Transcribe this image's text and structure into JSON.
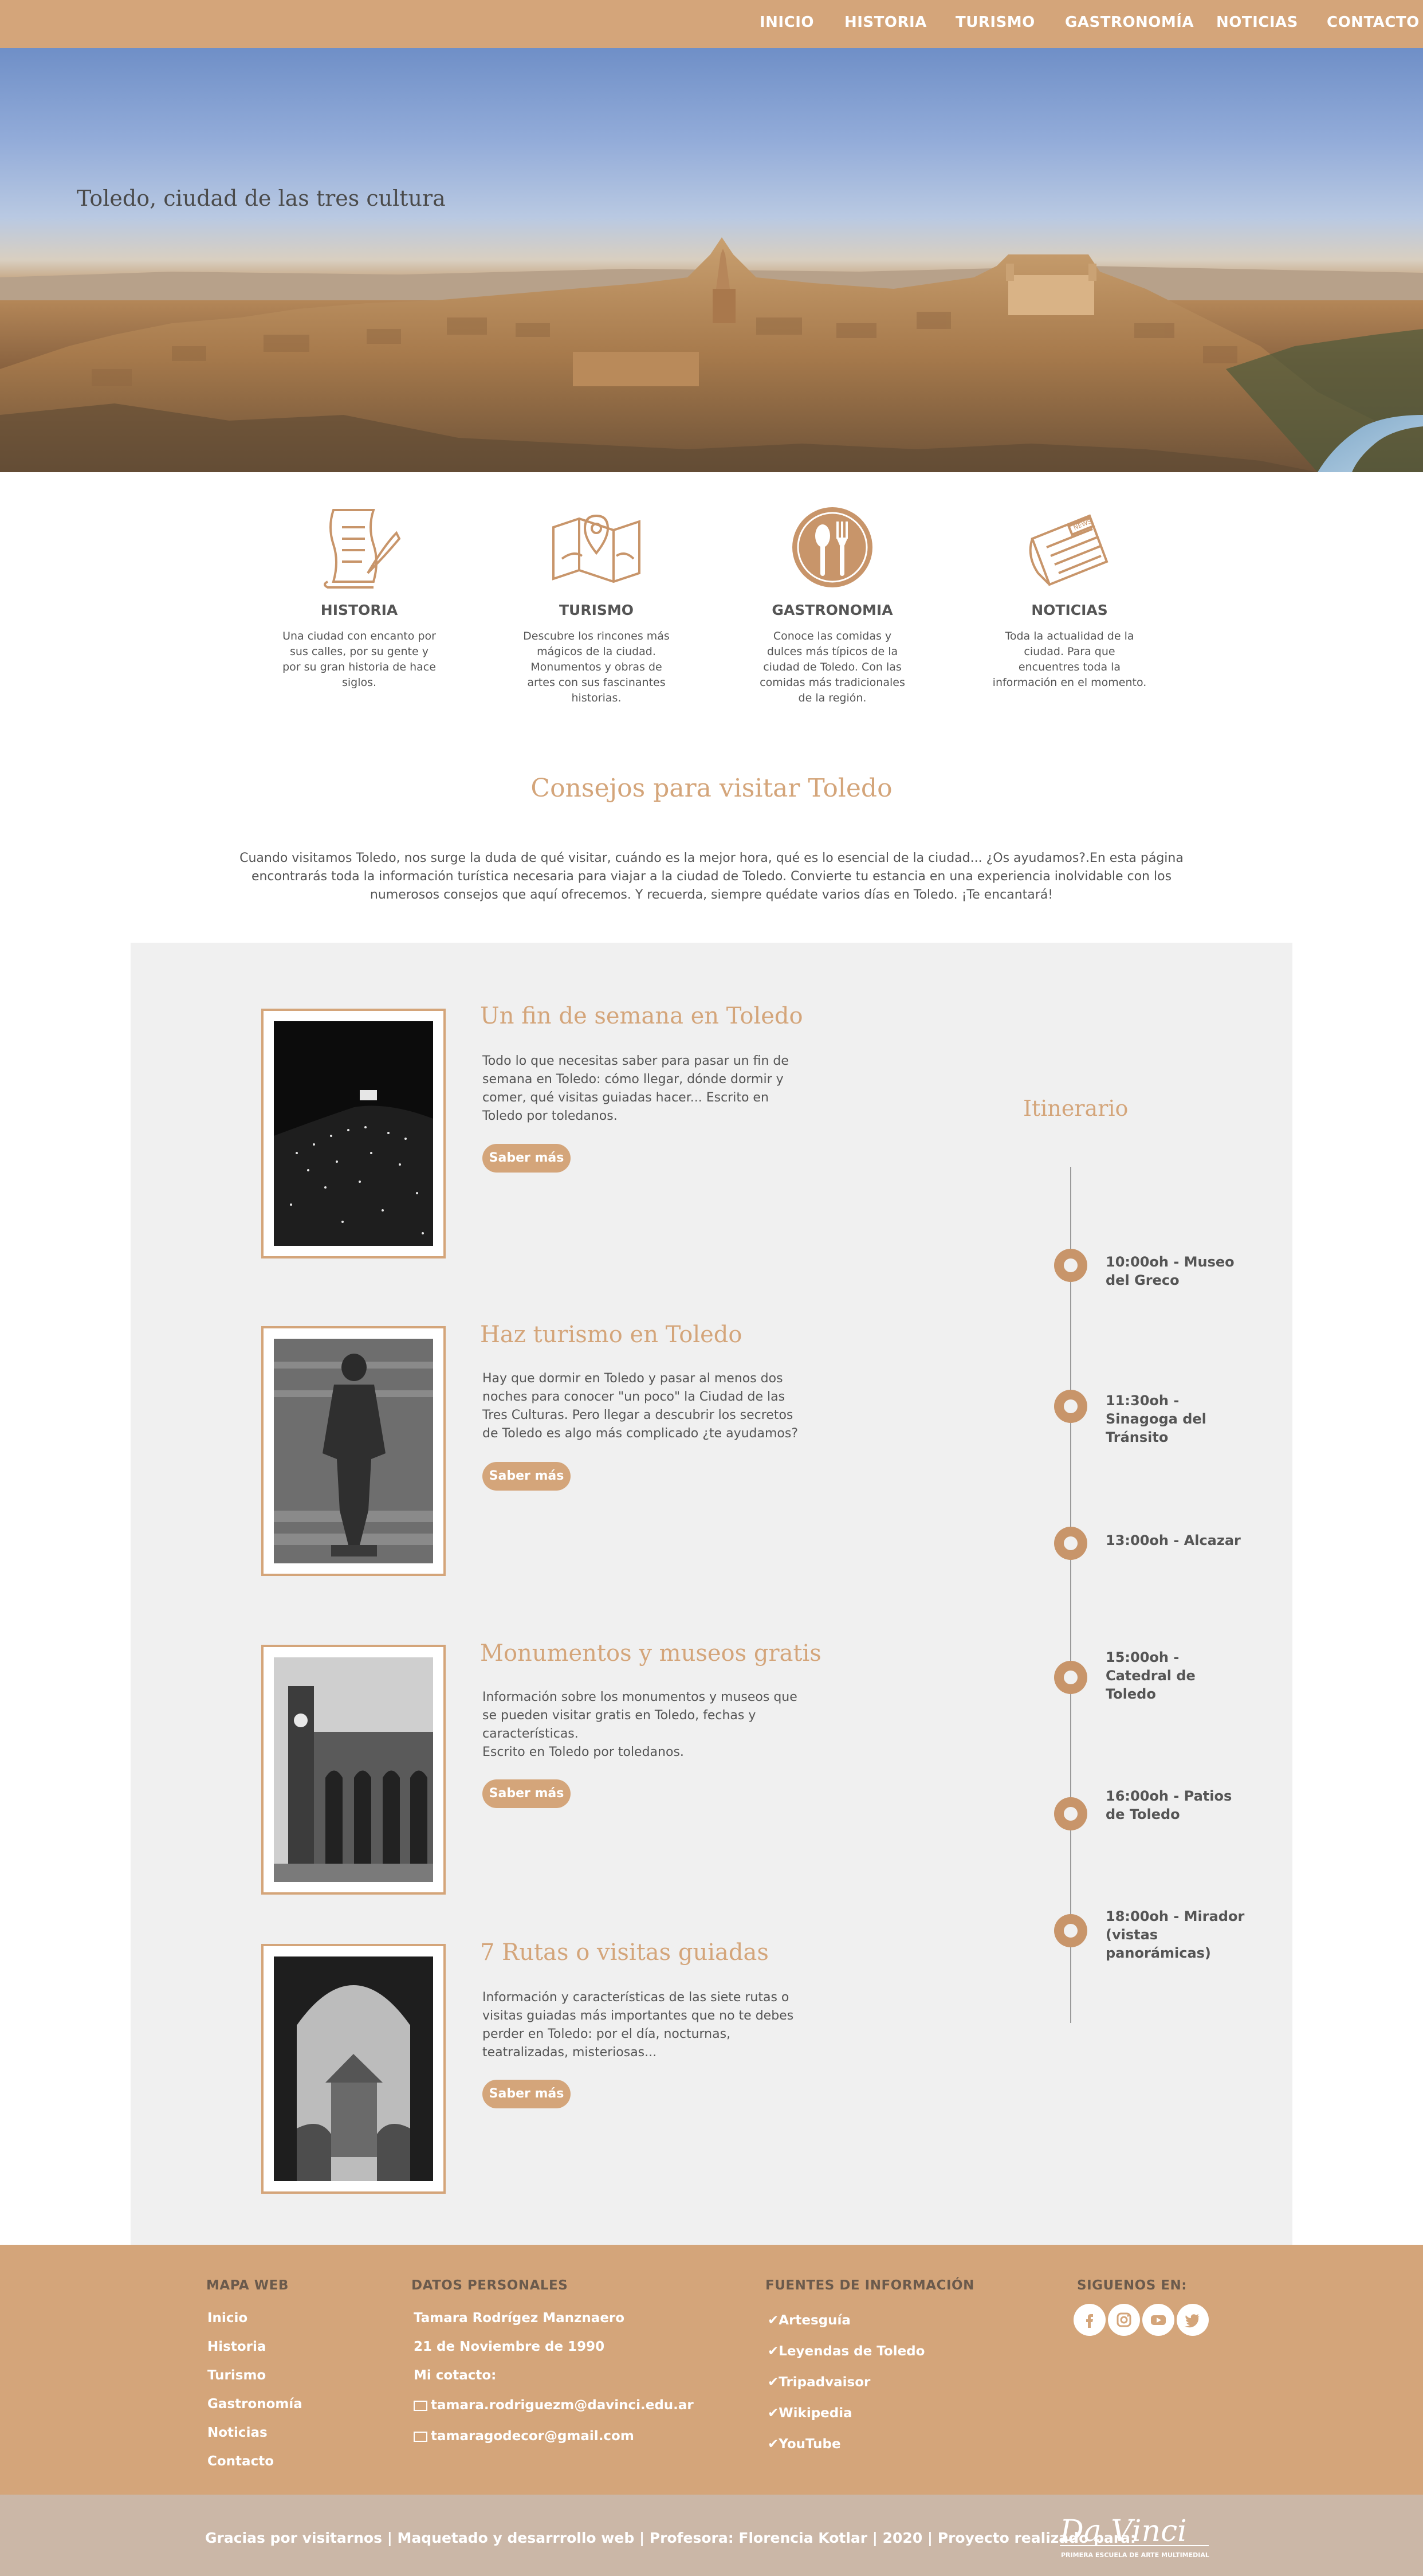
{
  "nav": {
    "items": [
      "INICIO",
      "HISTORIA",
      "TURISMO",
      "GASTRONOMÍA",
      "NOTICIAS",
      "CONTACTO"
    ]
  },
  "hero": {
    "title": "Toledo, ciudad de las tres cultura"
  },
  "features": [
    {
      "icon": "scroll-quill-icon",
      "title": "HISTORIA",
      "desc": "Una ciudad con encanto por sus calles, por su gente y por su gran historia de hace siglos."
    },
    {
      "icon": "map-pin-icon",
      "title": "TURISMO",
      "desc": "Descubre los rincones más mágicos de la ciudad. Monumentos y obras de artes con sus fascinantes historias."
    },
    {
      "icon": "spoon-fork-icon",
      "title": "GASTRONOMIA",
      "desc": "Conoce las comidas y dulces más típicos de la ciudad de Toledo. Con las comidas más tradicionales de la región."
    },
    {
      "icon": "newspaper-icon",
      "title": "NOTICIAS",
      "desc": "Toda la actualidad de la ciudad. Para que encuentres toda la información en el momento."
    }
  ],
  "advice": {
    "title": "Consejos para visitar Toledo",
    "intro": "Cuando visitamos Toledo, nos surge la duda de qué visitar, cuándo es la mejor hora, qué es lo esencial de la ciudad... ¿Os ayudamos?.En esta página encontrarás toda la información turística necesaria para viajar a la ciudad de Toledo. Convierte tu estancia en una experiencia inolvidable con los numerosos consejos que aquí ofrecemos. Y recuerda, siempre quédate varios días en Toledo. ¡Te encantará!",
    "cards": [
      {
        "title": "Un fin de semana en Toledo",
        "text": "Todo lo que necesitas saber para pasar un fin de semana en Toledo: cómo llegar, dónde dormir y comer, qué visitas guiadas hacer... Escrito en Toledo por toledanos.",
        "button": "Saber más"
      },
      {
        "title": "Haz turismo en Toledo",
        "text": "Hay que dormir en Toledo y pasar al menos dos noches para conocer \"un poco\" la Ciudad de las Tres Culturas. Pero llegar a descubrir los secretos de Toledo es algo más complicado ¿te ayudamos?",
        "button": "Saber más"
      },
      {
        "title": "Monumentos y museos gratis",
        "text": "Información sobre los monumentos y museos que se pueden visitar gratis en Toledo, fechas y características.",
        "text2": "Escrito en Toledo por toledanos.",
        "button": "Saber más"
      },
      {
        "title": "7 Rutas o visitas guiadas",
        "text": "Información y características de las siete rutas o visitas guiadas más importantes que no te debes perder en Toledo: por el día, nocturnas, teatralizadas, misteriosas...",
        "button": "Saber más"
      }
    ]
  },
  "itinerary": {
    "title": "Itinerario",
    "items": [
      "10:00oh - Museo del Greco",
      "11:30oh - Sinagoga del Tránsito",
      "13:00oh - Alcazar",
      "15:00oh - Catedral de Toledo",
      "16:00oh - Patios de Toledo",
      "18:00oh - Mirador (vistas panorámicas)"
    ]
  },
  "footer": {
    "sitemap": {
      "heading": "MAPA WEB",
      "links": [
        "Inicio",
        "Historia",
        "Turismo",
        "Gastronomía",
        "Noticias",
        "Contacto"
      ]
    },
    "personal": {
      "heading": "DATOS PERSONALES",
      "name": "Tamara Rodrígez Manznaero",
      "date": "21 de Noviembre de 1990",
      "contact_label": "Mi cotacto:",
      "email1": "tamara.rodriguezm@davinci.edu.ar",
      "email2": "tamaragodecor@gmail.com"
    },
    "sources": {
      "heading": "FUENTES DE INFORMACIÓN",
      "links": [
        "Artesguía",
        "Leyendas de Toledo",
        "Tripadvaisor",
        "Wikipedia",
        "YouTube"
      ]
    },
    "follow": {
      "heading": "SIGUENOS EN:",
      "icons": [
        "facebook-icon",
        "instagram-icon",
        "youtube-icon",
        "twitter-icon"
      ]
    },
    "bottom_text": "Gracias por visitarnos | Maquetado y desarrrollo web | Profesora: Florencia Kotlar | 2020 | Proyecto realizado para:",
    "logo_text": "Da Vinci",
    "logo_sub": "PRIMERA ESCUELA DE ARTE MULTIMEDIAL"
  },
  "colors": {
    "accent": "#d4a57a",
    "panel": "#f0f0f0",
    "bottom": "#cbb7a7",
    "text": "#555555"
  }
}
